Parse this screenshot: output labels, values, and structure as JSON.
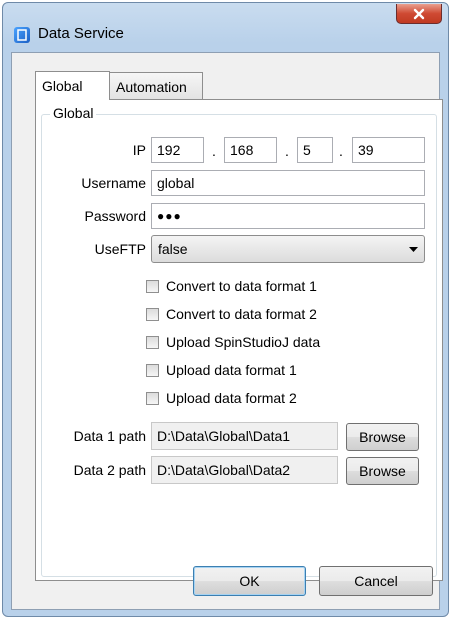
{
  "window": {
    "title": "Data Service"
  },
  "tabs": [
    {
      "label": "Global",
      "active": true
    },
    {
      "label": "Automation",
      "active": false
    }
  ],
  "group": {
    "title": "Global"
  },
  "ip": {
    "label": "IP",
    "octets": [
      "192",
      "168",
      "5",
      "39"
    ],
    "separator": "."
  },
  "username": {
    "label": "Username",
    "value": "global"
  },
  "password": {
    "label": "Password",
    "value": "●●●"
  },
  "useftp": {
    "label": "UseFTP",
    "value": "false"
  },
  "checkboxes": [
    {
      "label": "Convert to data format 1",
      "checked": false
    },
    {
      "label": "Convert to data format 2",
      "checked": false
    },
    {
      "label": "Upload SpinStudioJ data",
      "checked": false
    },
    {
      "label": "Upload data format 1",
      "checked": false
    },
    {
      "label": "Upload data format 2",
      "checked": false
    }
  ],
  "data1": {
    "label": "Data 1 path",
    "value": "D:\\Data\\Global\\Data1",
    "browse": "Browse"
  },
  "data2": {
    "label": "Data 2 path",
    "value": "D:\\Data\\Global\\Data2",
    "browse": "Browse"
  },
  "buttons": {
    "ok": "OK",
    "cancel": "Cancel"
  },
  "icons": {
    "app": "data-service-app-icon",
    "close": "close-icon",
    "dropdown": "chevron-down-icon"
  }
}
